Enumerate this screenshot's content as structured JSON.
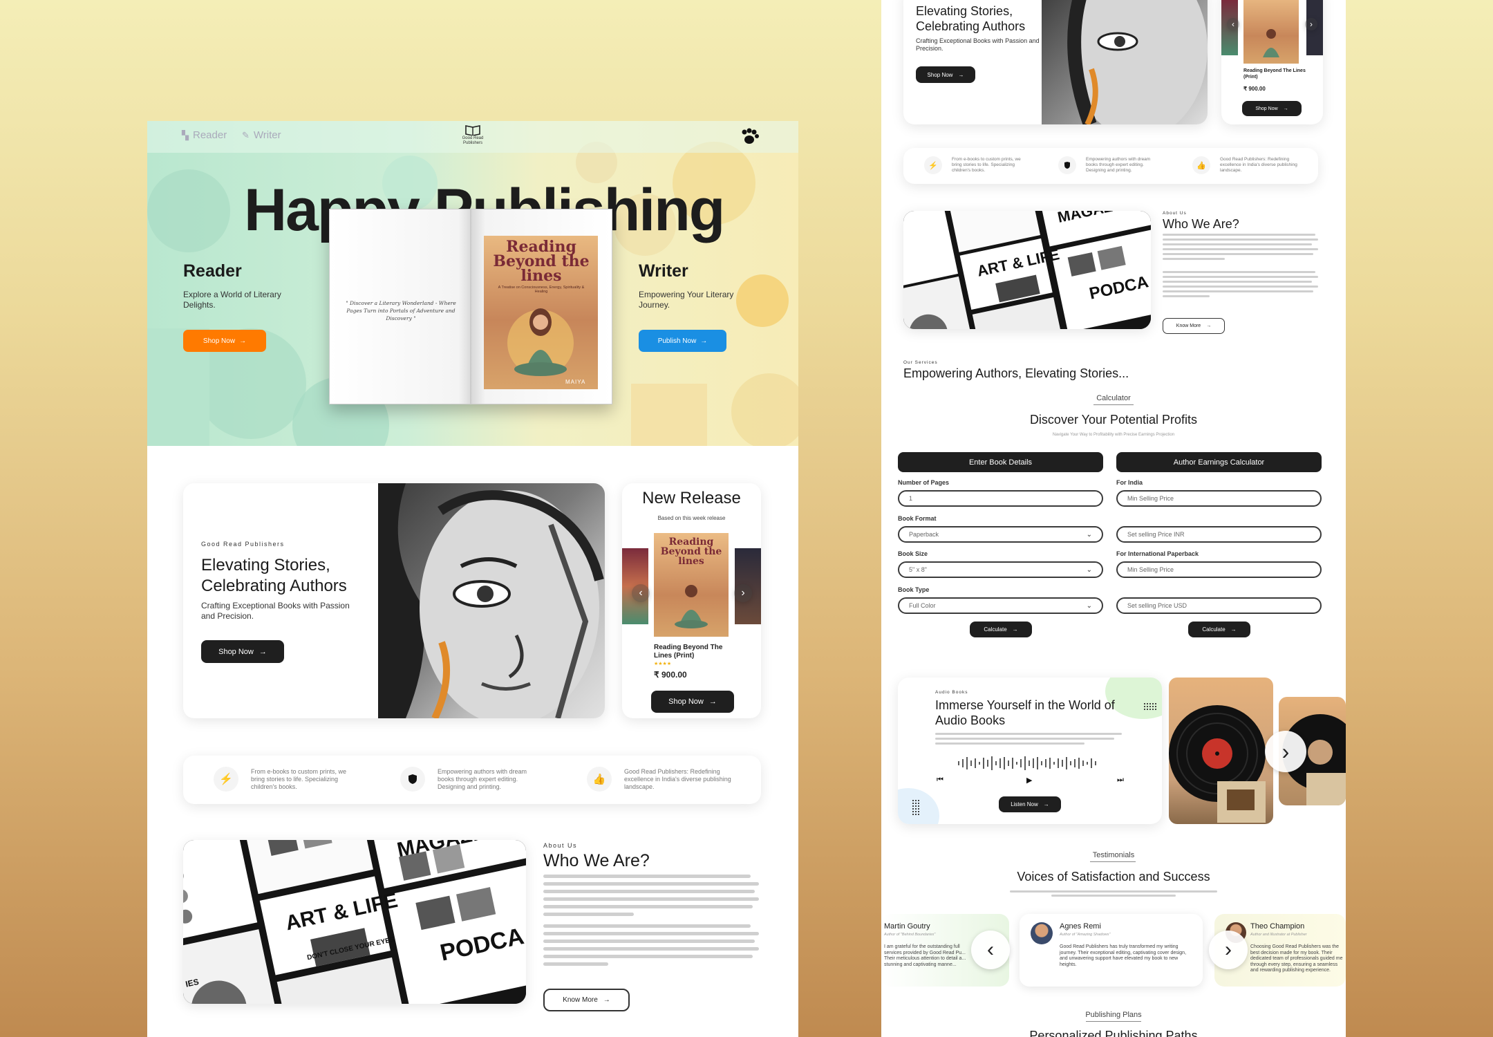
{
  "left": {
    "nav": {
      "reader": "Reader",
      "writer": "Writer",
      "logo": "Good Read Publishers"
    },
    "hero": {
      "title": "Happy Publishing",
      "reader_title": "Reader",
      "reader_sub": "Explore a World of Literary Delights.",
      "reader_btn": "Shop Now",
      "writer_title": "Writer",
      "writer_sub": "Empowering Your Literary Journey.",
      "writer_btn": "Publish Now",
      "book_quote": "\" Discover a Literary Wonderland - Where Pages Turn into Portals of Adventure and Discovery \"",
      "book_cover_title": "Reading Beyond the lines",
      "book_cover_sub": "A Treatise on Consciousness, Energy, Spirituality & Healing",
      "book_author": "MAIYA"
    },
    "promo": {
      "kicker": "Good Read Publishers",
      "title_1": "Elevating Stories,",
      "title_2": "Celebrating Authors",
      "sub": "Crafting Exceptional Books with Passion and Precision.",
      "btn": "Shop Now"
    },
    "release": {
      "title": "New Release",
      "sub": "Based on this week release",
      "book_title": "Reading Beyond The Lines (Print)",
      "stars": "★★★★",
      "price": "₹ 900.00",
      "btn": "Shop Now"
    },
    "features": [
      {
        "icon": "lightning-icon",
        "text": "From e-books to custom prints, we bring stories to life. Specializing children's books."
      },
      {
        "icon": "shield-icon",
        "text": "Empowering authors with dream books through expert editing. Designing and printing."
      },
      {
        "icon": "thumbs-up-icon",
        "text": "Good Read Publishers: Redefining excellence in India's diverse publishing landscape."
      }
    ],
    "about": {
      "kicker": "About Us",
      "title": "Who We Are?",
      "btn": "Know More",
      "collage": {
        "art": "ART & LIFE",
        "magazine": "MAGAZIN",
        "dont": "DON'T CLOSE YOUR EYES",
        "podcast": "PODCA",
        "ies": "IES"
      }
    }
  },
  "right": {
    "promo": {
      "title_1": "Elevating Stories,",
      "title_2": "Celebrating Authors",
      "sub": "Crafting Exceptional Books with Passion and Precision.",
      "btn": "Shop Now"
    },
    "release": {
      "book_title": "Reading Beyond The Lines (Print)",
      "price": "₹ 900.00",
      "btn": "Shop Now"
    },
    "features": [
      {
        "icon": "lightning-icon",
        "text": "From e-books to custom prints, we bring stories to life. Specializing children's books."
      },
      {
        "icon": "shield-icon",
        "text": "Empowering authors with dream books through expert editing. Designing and printing."
      },
      {
        "icon": "thumbs-up-icon",
        "text": "Good Read Publishers: Redefining excellence in India's diverse publishing landscape."
      }
    ],
    "about": {
      "kicker": "About Us",
      "title": "Who We Are?",
      "btn": "Know More"
    },
    "services": {
      "kicker": "Our Services",
      "title": "Empowering Authors, Elevating Stories..."
    },
    "calculator": {
      "tab": "Calculator",
      "title": "Discover Your Potential Profits",
      "sub": "Navigate Your Way to Profitability with Precise Earnings Projection",
      "left_head": "Enter Book Details",
      "right_head": "Author Earnings Calculator",
      "pages_label": "Number of Pages",
      "pages_value": "1",
      "format_label": "Book Format",
      "format_value": "Paperback",
      "size_label": "Book Size",
      "size_value": "5\" x 8\"",
      "type_label": "Book Type",
      "type_value": "Full Color",
      "india_label": "For India",
      "india_min": "Min Selling Price",
      "india_set": "Set selling Price INR",
      "intl_label": "For International Paperback",
      "intl_min": "Min Selling Price",
      "intl_set": "Set selling Price USD",
      "calc_btn": "Calculate"
    },
    "audio": {
      "kicker": "Audio Books",
      "title_1": "Immerse Yourself in the World of",
      "title_2": "Audio Books",
      "btn": "Listen Now"
    },
    "testimonials": {
      "tab": "Testimonials",
      "title": "Voices of Satisfaction and Success",
      "items": [
        {
          "name": "Martin Goutry",
          "role": "Author of \"Behind Boundaries\"",
          "text": "I am grateful for the outstanding full services provided by Good Read Pu... Their meticulous attention to detail a... stunning and captivating manne..."
        },
        {
          "name": "Agnes Remi",
          "role": "Author of \"Amazing Shadows\"",
          "text": "Good Read Publishers has truly transformed my writing journey. Their exceptional editing, captivating cover design, and unwavering support have elevated my book to new heights."
        },
        {
          "name": "Theo Champion",
          "role": "Author and Illustrator at Publisher",
          "text": "Choosing Good Read Publishers was the best decision made for my book. Their dedicated team of professionals guided me through every step, ensuring a seamless and rewarding publishing experience."
        }
      ]
    },
    "plans": {
      "tab": "Publishing Plans",
      "title": "Personalized Publishing Paths"
    }
  },
  "colors": {
    "orange": "#ff7a00",
    "blue": "#1a8fe3",
    "dark": "#1f1f1f"
  }
}
